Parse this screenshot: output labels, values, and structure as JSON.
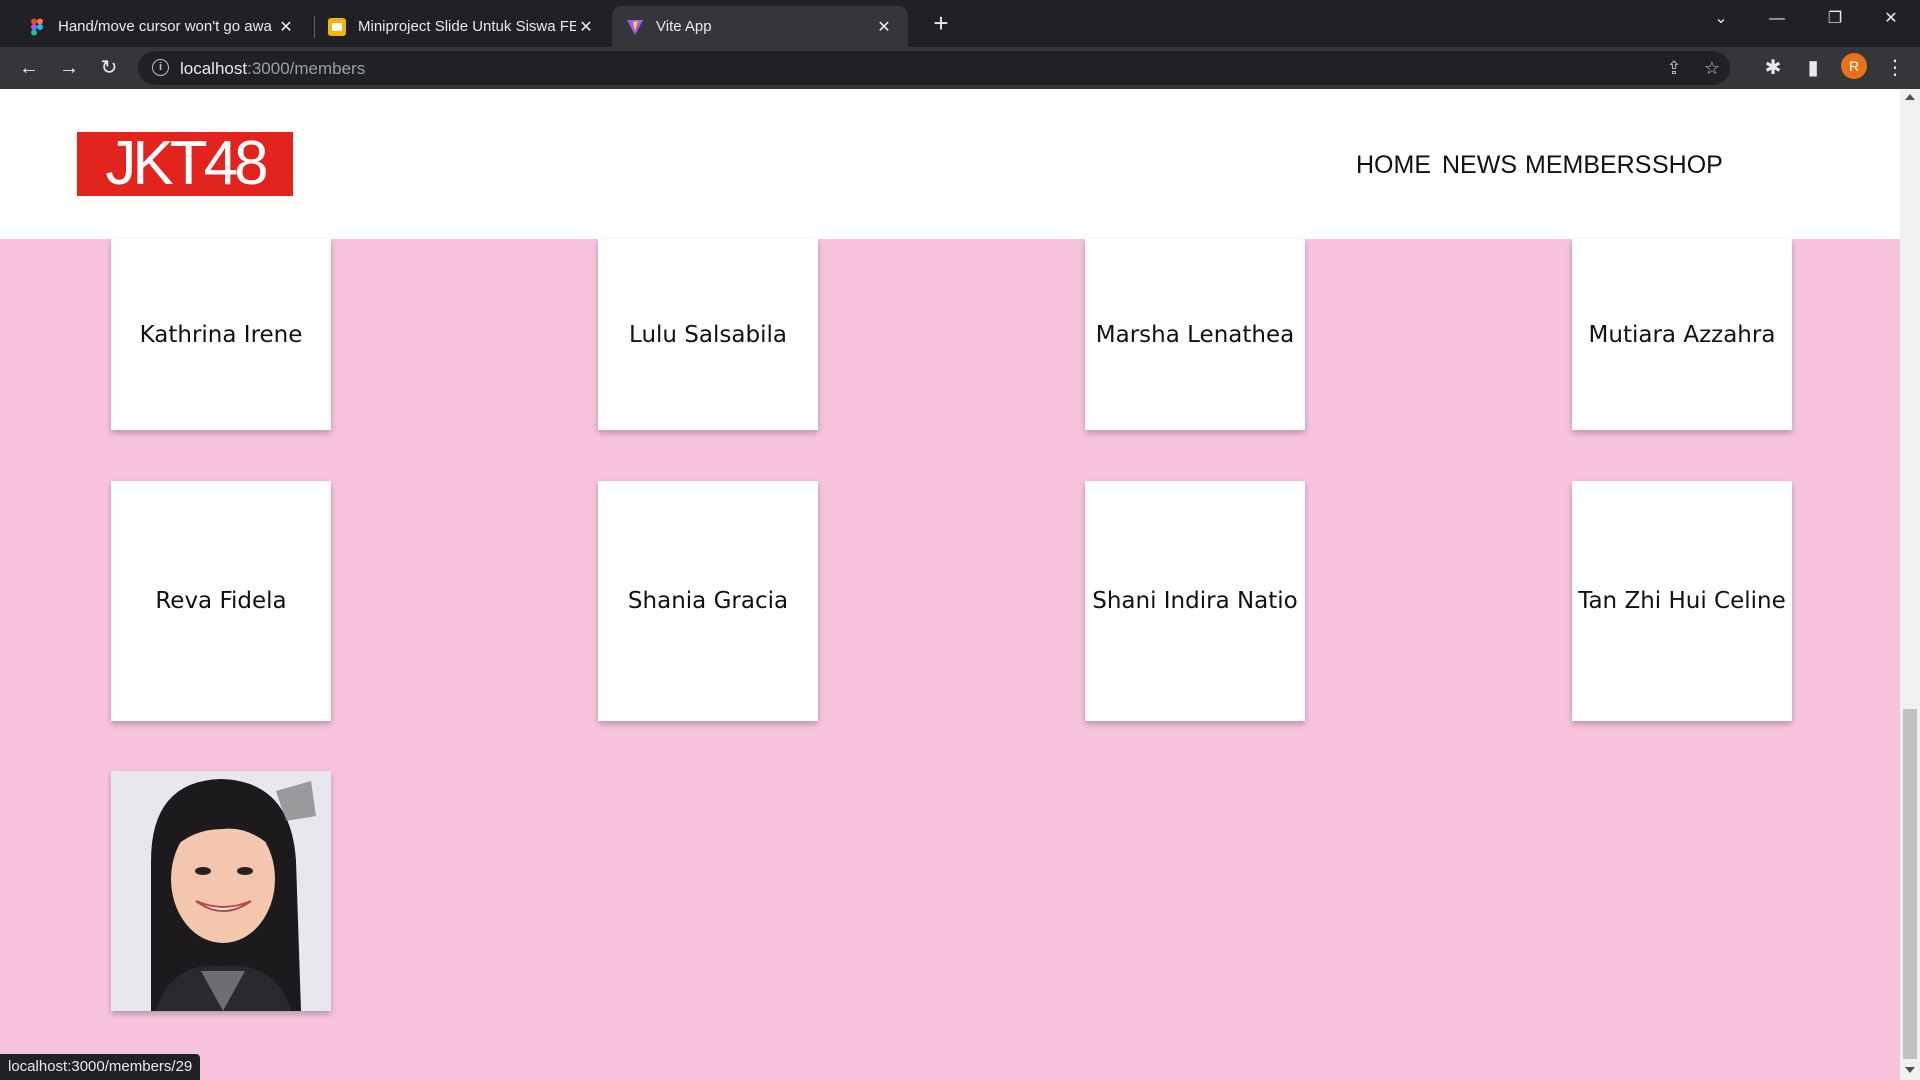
{
  "browser": {
    "tabs": [
      {
        "title": "Hand/move cursor won't go awa",
        "favicon_color": "#f24e1e"
      },
      {
        "title": "Miniproject Slide Untuk Siswa FE",
        "favicon_color": "#f4b400"
      },
      {
        "title": "Vite App",
        "favicon_color": "#a259ff"
      }
    ],
    "url_host": "localhost",
    "url_path": ":3000/members",
    "profile_initial": "R",
    "status_url": "localhost:3000/members/29"
  },
  "site": {
    "logo_text": "JKT48",
    "logo_color": "#e3231e",
    "background_color": "#f8c4dd",
    "nav": [
      "HOME",
      "NEWS",
      "MEMBERS",
      "SHOP"
    ]
  },
  "members": [
    "Kathrina Irene",
    "Lulu Salsabila",
    "Marsha Lenathea",
    "Mutiara Azzahra",
    "Reva Fidela",
    "Shania Gracia",
    "Shani Indira Natio",
    "Tan Zhi Hui Celine"
  ]
}
